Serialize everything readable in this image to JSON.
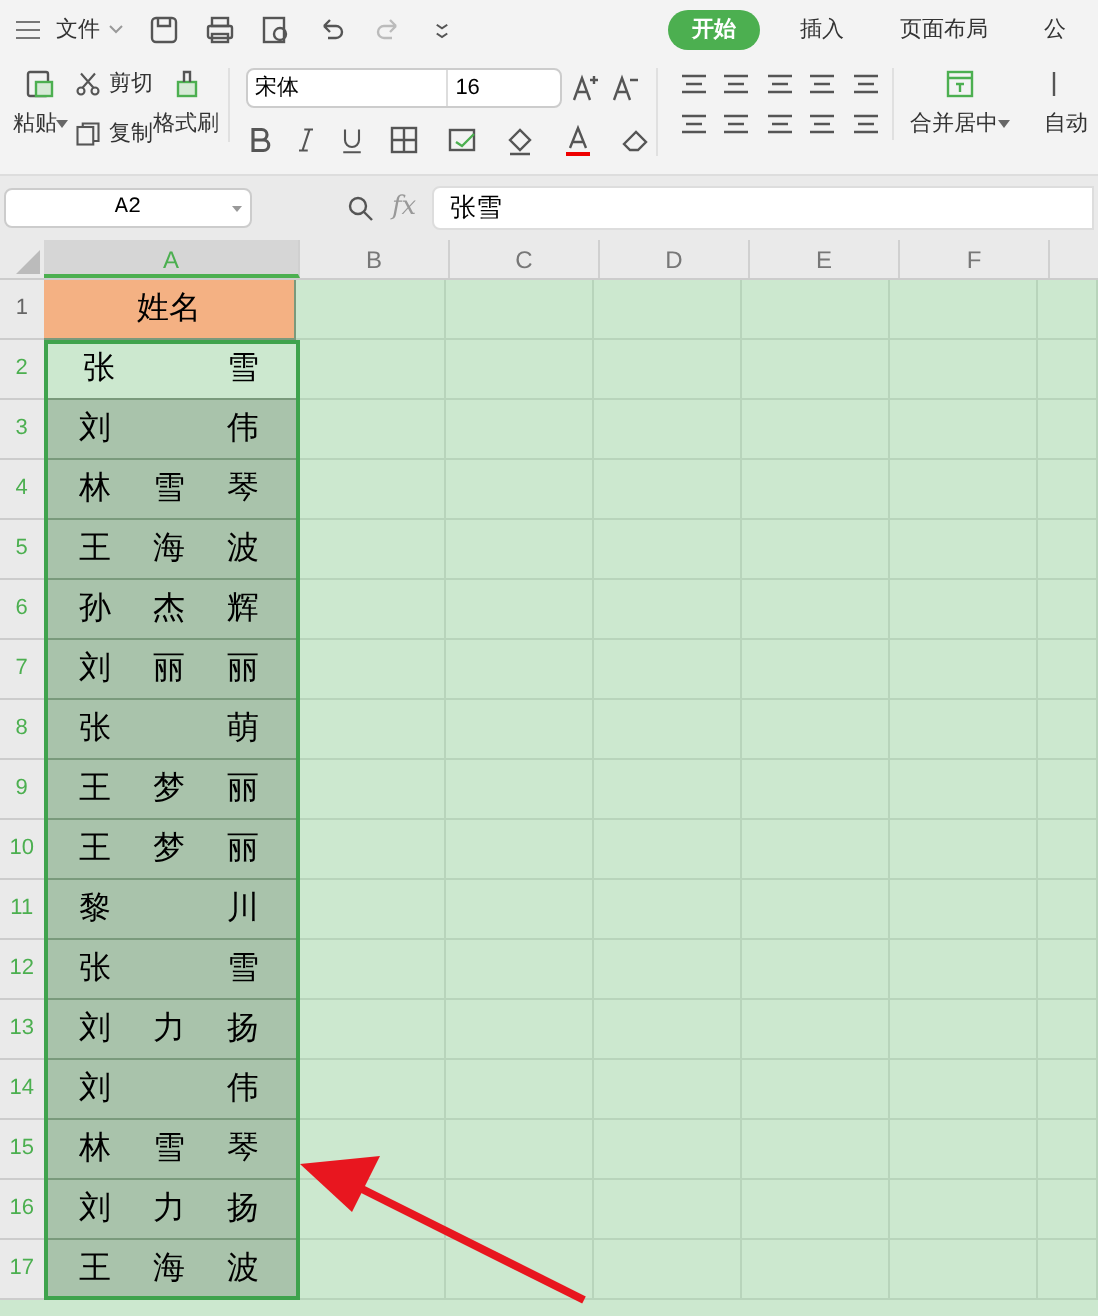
{
  "menu": {
    "file": "文件"
  },
  "tabs": [
    {
      "label": "开始",
      "selected": true
    },
    {
      "label": "插入",
      "selected": false
    },
    {
      "label": "页面布局",
      "selected": false
    },
    {
      "label": "公",
      "selected": false
    }
  ],
  "ribbon": {
    "paste": "粘贴",
    "cut": "剪切",
    "copy": "复制",
    "format_painter": "格式刷",
    "font_name": "宋体",
    "font_size": "16",
    "merge": "合并居中",
    "wrap": "自动"
  },
  "formula_bar": {
    "name_box": "A2",
    "fx": "fx",
    "value": "张雪"
  },
  "columns": [
    {
      "label": "A",
      "selected": true
    },
    {
      "label": "B",
      "selected": false
    },
    {
      "label": "C",
      "selected": false
    },
    {
      "label": "D",
      "selected": false
    },
    {
      "label": "E",
      "selected": false
    },
    {
      "label": "F",
      "selected": false
    }
  ],
  "rows": [
    {
      "number": "1",
      "value": "姓名",
      "kind": "header",
      "selected": false,
      "active": false
    },
    {
      "number": "2",
      "value": "张雪",
      "kind": "name",
      "selected": true,
      "active": true
    },
    {
      "number": "3",
      "value": "刘伟",
      "kind": "name",
      "selected": true,
      "active": false
    },
    {
      "number": "4",
      "value": "林雪琴",
      "kind": "name",
      "selected": true,
      "active": false
    },
    {
      "number": "5",
      "value": "王海波",
      "kind": "name",
      "selected": true,
      "active": false
    },
    {
      "number": "6",
      "value": "孙杰辉",
      "kind": "name",
      "selected": true,
      "active": false
    },
    {
      "number": "7",
      "value": "刘丽丽",
      "kind": "name",
      "selected": true,
      "active": false
    },
    {
      "number": "8",
      "value": "张萌",
      "kind": "name",
      "selected": true,
      "active": false
    },
    {
      "number": "9",
      "value": "王梦丽",
      "kind": "name",
      "selected": true,
      "active": false
    },
    {
      "number": "10",
      "value": "王梦丽",
      "kind": "name",
      "selected": true,
      "active": false
    },
    {
      "number": "11",
      "value": "黎川",
      "kind": "name",
      "selected": true,
      "active": false
    },
    {
      "number": "12",
      "value": "张雪",
      "kind": "name",
      "selected": true,
      "active": false
    },
    {
      "number": "13",
      "value": "刘力扬",
      "kind": "name",
      "selected": true,
      "active": false
    },
    {
      "number": "14",
      "value": "刘伟",
      "kind": "name",
      "selected": true,
      "active": false
    },
    {
      "number": "15",
      "value": "林雪琴",
      "kind": "name",
      "selected": true,
      "active": false
    },
    {
      "number": "16",
      "value": "刘力扬",
      "kind": "name",
      "selected": true,
      "active": false
    },
    {
      "number": "17",
      "value": "王海波",
      "kind": "name",
      "selected": true,
      "active": false
    }
  ],
  "annotation": {
    "kind": "arrow"
  }
}
